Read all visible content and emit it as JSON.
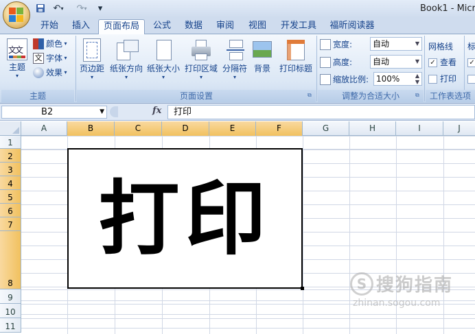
{
  "window": {
    "title": "Book1 - Micr"
  },
  "qat": {
    "undo": "↶",
    "redo": "↷",
    "customize": "▾"
  },
  "tabs": [
    {
      "label": "开始"
    },
    {
      "label": "插入"
    },
    {
      "label": "页面布局",
      "active": true
    },
    {
      "label": "公式"
    },
    {
      "label": "数据"
    },
    {
      "label": "审阅"
    },
    {
      "label": "视图"
    },
    {
      "label": "开发工具"
    },
    {
      "label": "福昕阅读器"
    }
  ],
  "ribbon": {
    "theme_group": {
      "label": "主题",
      "theme_button": "主题",
      "colors": "颜色",
      "fonts": "字体",
      "effects": "效果",
      "theme_icon_text": "文文"
    },
    "page_setup_group": {
      "label": "页面设置",
      "buttons": [
        "页边距",
        "纸张方向",
        "纸张大小",
        "打印区域",
        "分隔符",
        "背景",
        "打印标题"
      ]
    },
    "scale_group": {
      "label": "调整为合适大小",
      "width_label": "宽度:",
      "width_value": "自动",
      "height_label": "高度:",
      "height_value": "自动",
      "scale_label": "缩放比例:",
      "scale_value": "100%"
    },
    "sheet_options_group": {
      "label": "工作表选项",
      "gridlines": "网格线",
      "view": "查看",
      "print": "打印",
      "headings_partial": "标"
    }
  },
  "formula_bar": {
    "name_box": "B2",
    "fx": "fx",
    "content": "打印"
  },
  "columns": [
    "A",
    "B",
    "C",
    "D",
    "E",
    "F",
    "G",
    "H",
    "I",
    "J"
  ],
  "rows": [
    "1",
    "2",
    "3",
    "4",
    "5",
    "6",
    "7",
    "8",
    "9",
    "10",
    "11"
  ],
  "cell": {
    "merged_text": "打印"
  },
  "watermark": {
    "text": "搜狗指南",
    "url": "zhinan.sogou.com"
  },
  "colors": {
    "selected_header": "#f4c566",
    "ribbon_text": "#15428b"
  }
}
